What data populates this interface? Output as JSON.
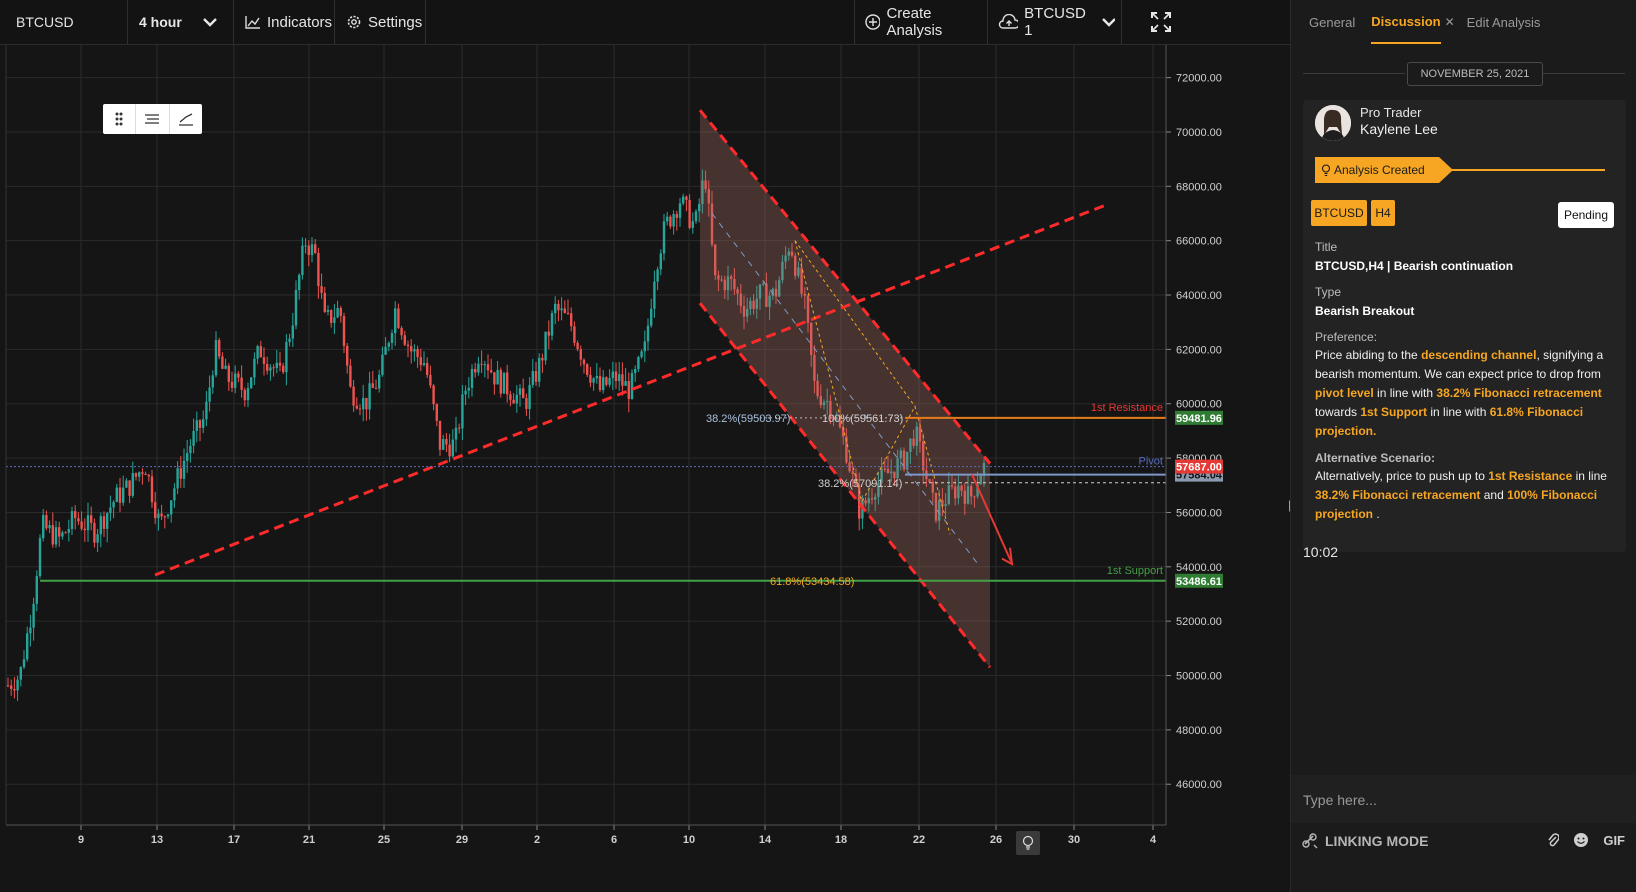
{
  "toolbar": {
    "symbol": "BTCUSD",
    "interval": "4 hour",
    "indicators_label": "Indicators",
    "settings_label": "Settings",
    "create_analysis_label": "Create Analysis",
    "layout_label": "BTCUSD 1"
  },
  "chart_data": {
    "type": "candlestick",
    "symbol": "BTCUSD",
    "timeframe": "4 hour",
    "ylim": [
      44500,
      73200
    ],
    "y_ticks": [
      "72000.00",
      "70000.00",
      "68000.00",
      "66000.00",
      "64000.00",
      "62000.00",
      "60000.00",
      "58000.00",
      "56000.00",
      "54000.00",
      "52000.00",
      "50000.00",
      "48000.00",
      "46000.00"
    ],
    "x_ticks": [
      "9",
      "13",
      "17",
      "21",
      "25",
      "29",
      "2",
      "6",
      "10",
      "14",
      "18",
      "22",
      "26",
      "30",
      "4"
    ],
    "close_path": [
      [
        0,
        49400
      ],
      [
        20,
        50000
      ],
      [
        32,
        52500
      ],
      [
        42,
        55500
      ],
      [
        60,
        55000
      ],
      [
        75,
        55800
      ],
      [
        95,
        55300
      ],
      [
        115,
        56500
      ],
      [
        130,
        57000
      ],
      [
        145,
        57800
      ],
      [
        160,
        55500
      ],
      [
        175,
        57000
      ],
      [
        190,
        58500
      ],
      [
        205,
        59500
      ],
      [
        215,
        62000
      ],
      [
        225,
        61000
      ],
      [
        245,
        60500
      ],
      [
        260,
        62000
      ],
      [
        280,
        61000
      ],
      [
        292,
        63000
      ],
      [
        305,
        66000
      ],
      [
        315,
        65500
      ],
      [
        325,
        63000
      ],
      [
        340,
        63500
      ],
      [
        350,
        60500
      ],
      [
        365,
        60000
      ],
      [
        380,
        61000
      ],
      [
        395,
        63500
      ],
      [
        410,
        62000
      ],
      [
        425,
        61500
      ],
      [
        440,
        58500
      ],
      [
        455,
        58500
      ],
      [
        465,
        60500
      ],
      [
        480,
        62000
      ],
      [
        495,
        61000
      ],
      [
        510,
        60500
      ],
      [
        525,
        60000
      ],
      [
        540,
        61500
      ],
      [
        555,
        63500
      ],
      [
        570,
        63000
      ],
      [
        585,
        61500
      ],
      [
        600,
        60500
      ],
      [
        615,
        61000
      ],
      [
        630,
        60500
      ],
      [
        645,
        62000
      ],
      [
        655,
        65000
      ],
      [
        665,
        66500
      ],
      [
        680,
        67500
      ],
      [
        695,
        66500
      ],
      [
        705,
        68500
      ],
      [
        715,
        64500
      ],
      [
        730,
        64500
      ],
      [
        745,
        63500
      ],
      [
        760,
        64000
      ],
      [
        775,
        64000
      ],
      [
        790,
        66000
      ],
      [
        805,
        63500
      ],
      [
        815,
        60500
      ],
      [
        830,
        60000
      ],
      [
        845,
        58500
      ],
      [
        860,
        56000
      ],
      [
        875,
        57000
      ],
      [
        890,
        57500
      ],
      [
        905,
        58000
      ],
      [
        915,
        59000
      ],
      [
        925,
        57500
      ],
      [
        935,
        56000
      ],
      [
        945,
        56500
      ],
      [
        960,
        57000
      ],
      [
        970,
        56500
      ],
      [
        980,
        57500
      ],
      [
        985,
        57700
      ]
    ],
    "annotations": [
      {
        "label": "1st Resistance",
        "value": "59481.96",
        "color": "#e53935"
      },
      {
        "label": "Pivot",
        "value": "57687.00",
        "color": "#5c6bc0"
      },
      {
        "label": "",
        "value": "57584.04",
        "color": "#90a4ae"
      },
      {
        "label": "1st Support",
        "value": "53486.61",
        "color": "#43a047"
      }
    ],
    "fib_labels": [
      {
        "text": "38.2%(59503.97)"
      },
      {
        "text": "100%(59561.73)"
      },
      {
        "text": "38.2%(57091.14)"
      },
      {
        "text": "61.8%(53434.58)"
      }
    ],
    "channel": {
      "upper": [
        [
          700,
          70800
        ],
        [
          990,
          57800
        ]
      ],
      "lower": [
        [
          700,
          63700
        ],
        [
          990,
          50300
        ]
      ]
    },
    "trendline": {
      "from": [
        155,
        53700
      ],
      "to": [
        1105,
        67300
      ]
    },
    "grid": true
  },
  "panel": {
    "tabs": [
      "General",
      "Discussion",
      "Edit Analysis"
    ],
    "active_tab": "Discussion",
    "date": "NOVEMBER 25, 2021",
    "author_role": "Pro Trader",
    "author_name": "Kaylene Lee",
    "status": "Analysis Created",
    "tag_symbol": "BTCUSD",
    "tag_tf": "H4",
    "state": "Pending",
    "title_label": "Title",
    "title_value": "BTCUSD,H4 | Bearish continuation",
    "type_label": "Type",
    "type_value": "Bearish Breakout",
    "preference_label": "Preference:",
    "pref": [
      "Price abiding to the ",
      "descending channel",
      ", signifying a bearish momentum. We can expect price to drop from ",
      "pivot level",
      " in line with ",
      "38.2% Fibonacci retracement",
      " towards ",
      "1st Support",
      " in line with ",
      "61.8% Fibonacci projection."
    ],
    "alt_label": "Alternative Scenario:",
    "alt": [
      "Alternatively, price to push up to ",
      "1st Resistance",
      " in line ",
      "38.2% Fibonacci retracement",
      " and ",
      "100% Fibonacci projection",
      " ."
    ],
    "time": "10:02",
    "input_placeholder": "Type here...",
    "linking_mode": "LINKING MODE",
    "gif": "GIF"
  },
  "colors": {
    "accent": "#f6a623",
    "up": "#26a69a",
    "down": "#ef5350",
    "resistance": "#e53935",
    "support": "#43a047"
  }
}
